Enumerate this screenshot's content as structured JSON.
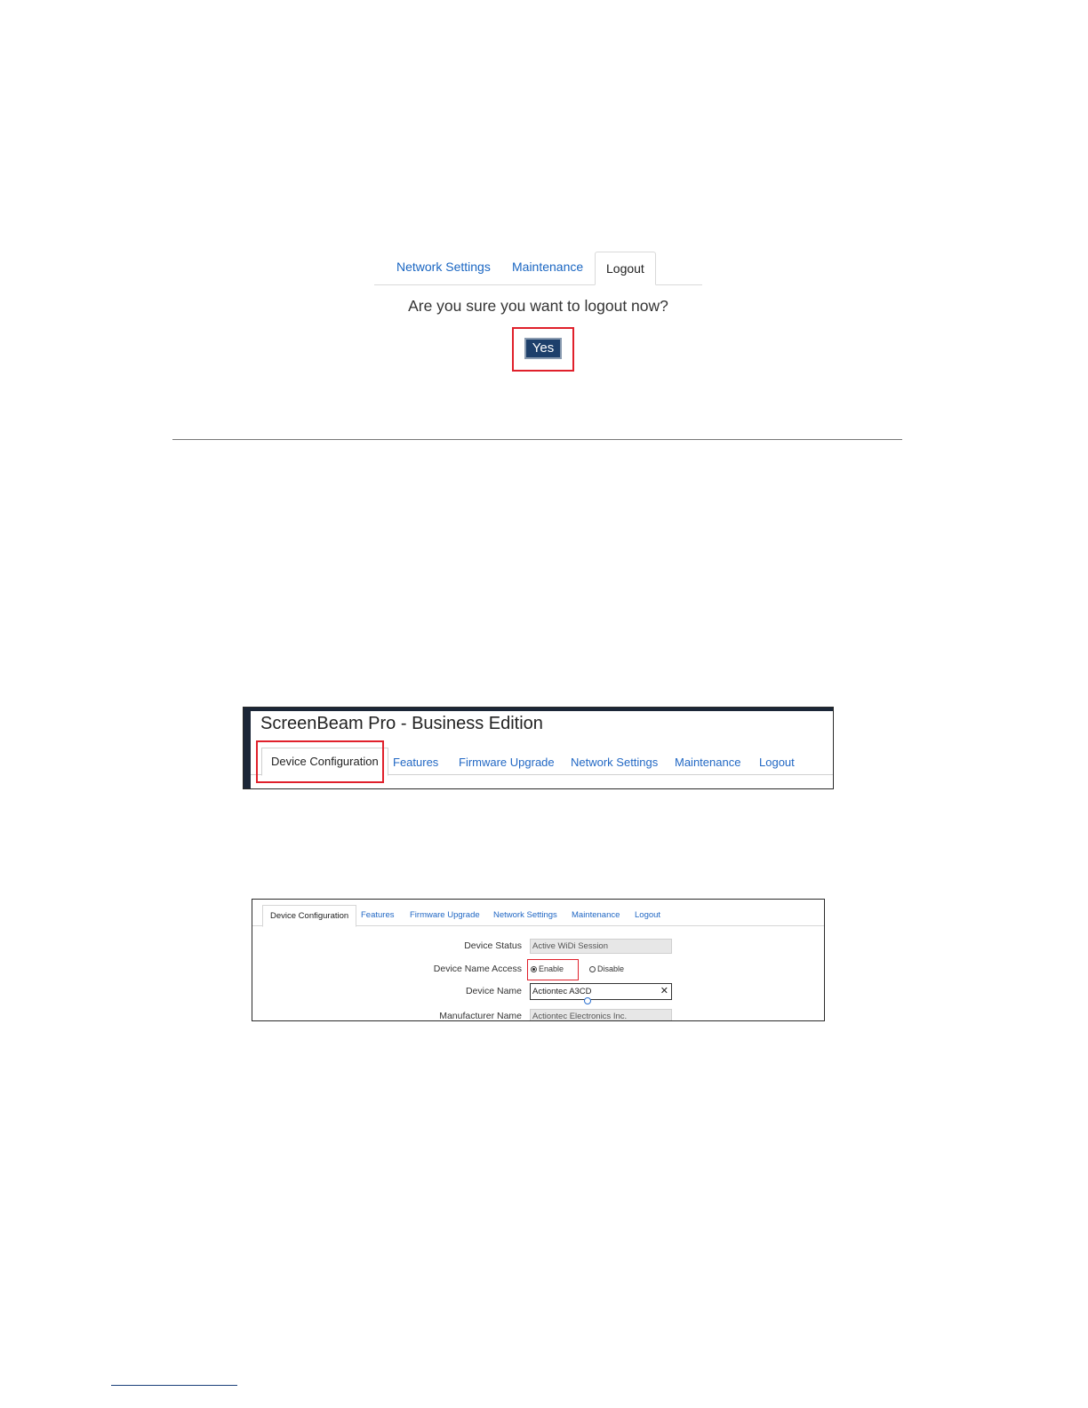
{
  "logout_panel": {
    "tabs": [
      "Network Settings",
      "Maintenance",
      "Logout"
    ],
    "active_tab": "Logout",
    "question": "Are you sure you want to logout now?",
    "yes_label": "Yes"
  },
  "header_panel": {
    "app_title": "ScreenBeam Pro - Business Edition",
    "tabs": [
      "Device Configuration",
      "Features",
      "Firmware Upgrade",
      "Network Settings",
      "Maintenance",
      "Logout"
    ],
    "active_tab": "Device Configuration"
  },
  "config_panel": {
    "tabs": [
      "Device Configuration",
      "Features",
      "Firmware Upgrade",
      "Network Settings",
      "Maintenance",
      "Logout"
    ],
    "active_tab": "Device Configuration",
    "fields": {
      "device_status": {
        "label": "Device Status",
        "value": "Active WiDi Session"
      },
      "device_name_access": {
        "label": "Device Name Access",
        "enable_label": "Enable",
        "disable_label": "Disable",
        "selected": "Enable"
      },
      "device_name": {
        "label": "Device Name",
        "value": "Actiontec A3CD",
        "clear_icon": "close-icon"
      },
      "manufacturer_name": {
        "label": "Manufacturer Name",
        "value": "Actiontec Electronics Inc."
      }
    }
  },
  "colors": {
    "link": "#1a66c2",
    "highlight": "#e0202b",
    "yes_button": "#1d3f6b",
    "header_bar": "#1b2637"
  }
}
